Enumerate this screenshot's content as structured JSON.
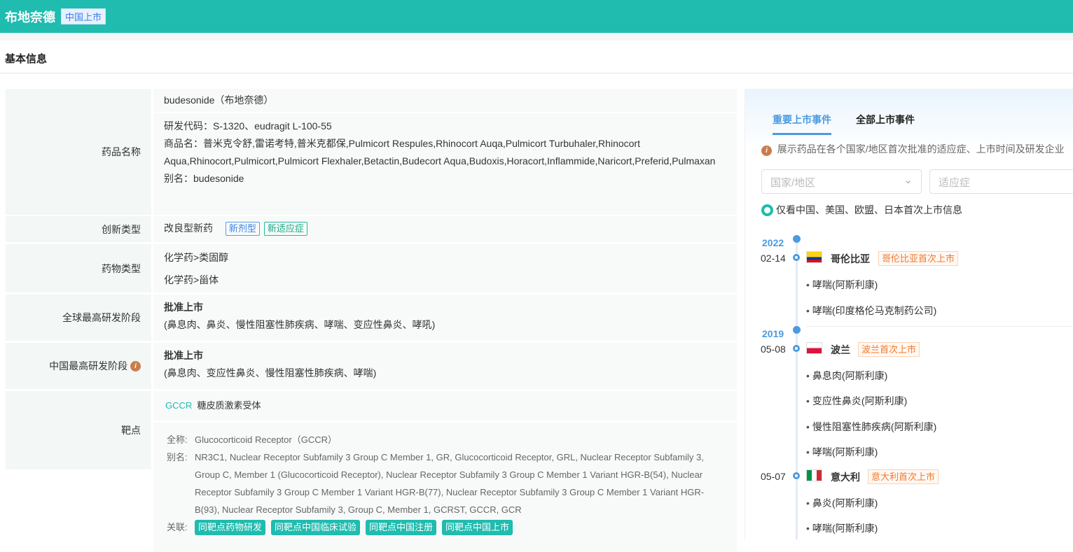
{
  "header": {
    "title": "布地奈德",
    "badge": "中国上市"
  },
  "section_title": "基本信息",
  "drug": {
    "name_label": "药品名称",
    "name": "budesonide（布地奈德）",
    "code": "研发代码：S-1320、eudragit L-100-55",
    "trade_names": "商品名：普米克令舒,雷诺考特,普米克都保,Pulmicort Respules,Rhinocort Auqa,Pulmicort Turbuhaler,Rhinocort Aqua,Rhinocort,Pulmicort,Pulmicort Flexhaler,Betactin,Budecort Aqua,Budoxis,Horacort,Inflammide,Naricort,Preferid,Pulmaxan",
    "alias": "别名：budesonide",
    "innovation_label": "创新类型",
    "innovation": "改良型新药",
    "innovation_tags": [
      "新剂型",
      "新适应症"
    ],
    "type_label": "药物类型",
    "types": [
      "化学药>类固醇",
      "化学药>甾体"
    ],
    "global_label": "全球最高研发阶段",
    "global_stage": "批准上市",
    "global_ind": "(鼻息肉、鼻炎、慢性阻塞性肺疾病、哮喘、变应性鼻炎、哮吼)",
    "china_label": "中国最高研发阶段",
    "china_stage": "批准上市",
    "china_ind": "(鼻息肉、变应性鼻炎、慢性阻塞性肺疾病、哮喘)",
    "target_label": "靶点",
    "target_code": "GCCR",
    "target_name": "糖皮质激素受体",
    "fullname_label": "全称:",
    "fullname": "Glucocorticoid Receptor（GCCR）",
    "target_alias_label": "别名:",
    "target_alias": "NR3C1, Nuclear Receptor Subfamily 3 Group C Member 1, GR, Glucocorticoid Receptor, GRL, Nuclear Receptor Subfamily 3, Group C, Member 1 (Glucocorticoid Receptor), Nuclear Receptor Subfamily 3 Group C Member 1 Variant HGR-B(54), Nuclear Receptor Subfamily 3 Group C Member 1 Variant HGR-B(77), Nuclear Receptor Subfamily 3 Group C Member 1 Variant HGR-B(93), Nuclear Receptor Subfamily 3, Group C, Member 1, GCRST, GCCR, GCR",
    "related_label": "关联:",
    "related": [
      "同靶点药物研发",
      "同靶点中国临床试验",
      "同靶点中国注册",
      "同靶点中国上市"
    ]
  },
  "events": {
    "tabs": [
      "重要上市事件",
      "全部上市事件"
    ],
    "note": "展示药品在各个国家/地区首次批准的适应症、上市时间及研发企业",
    "country_placeholder": "国家/地区",
    "indication_placeholder": "适应症",
    "toggle_label": "仅看中国、美国、欧盟、日本首次上市信息",
    "timeline": [
      {
        "year": "2022",
        "date": "02-14",
        "country": "哥伦比亚",
        "tag": "哥伦比亚首次上市",
        "items": [
          "哮喘(阿斯利康)",
          "哮喘(印度格伦马克制药公司)"
        ]
      },
      {
        "year": "2019",
        "date": "05-08",
        "country": "波兰",
        "tag": "波兰首次上市",
        "items": [
          "鼻息肉(阿斯利康)",
          "变应性鼻炎(阿斯利康)",
          "慢性阻塞性肺疾病(阿斯利康)",
          "哮喘(阿斯利康)"
        ]
      },
      {
        "date": "05-07",
        "country": "意大利",
        "tag": "意大利首次上市",
        "items": [
          "鼻炎(阿斯利康)",
          "哮喘(阿斯利康)"
        ]
      }
    ]
  },
  "colors": {
    "brand": "#1fbcaf",
    "accent": "#4a9be0",
    "orange": "#f07a2c"
  }
}
